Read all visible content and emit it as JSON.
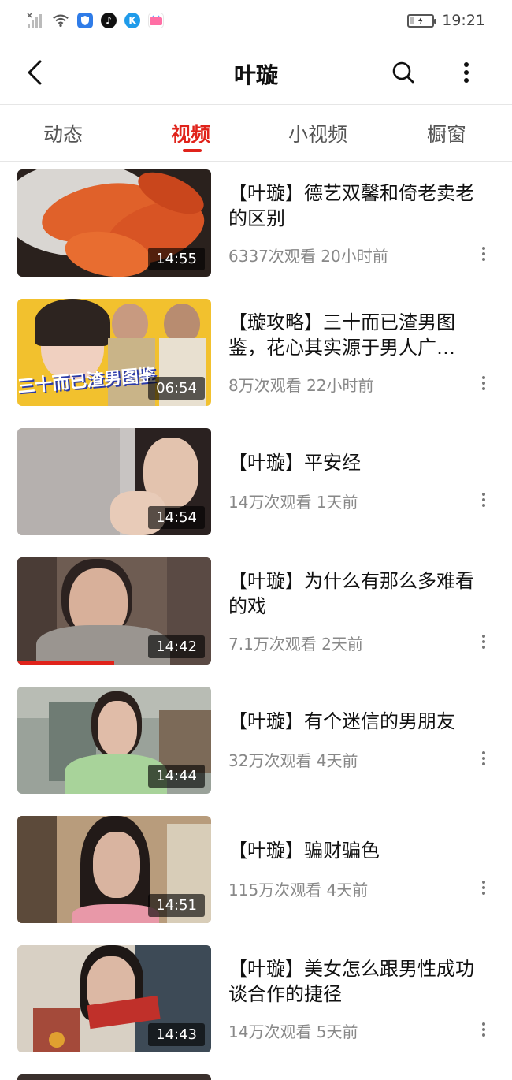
{
  "status_bar": {
    "time": "19:21",
    "icons": [
      "signal-icon",
      "wifi-icon",
      "shield-app-icon",
      "tiktok-app-icon",
      "k-app-icon",
      "bilibili-app-icon"
    ],
    "battery_level": 0.2
  },
  "header": {
    "title": "叶璇",
    "back_icon": "back-arrow-icon",
    "search_icon": "search-icon",
    "more_icon": "more-vertical-icon"
  },
  "tabs": [
    {
      "label": "动态",
      "active": false
    },
    {
      "label": "视频",
      "active": true
    },
    {
      "label": "小视频",
      "active": false
    },
    {
      "label": "橱窗",
      "active": false
    }
  ],
  "colors": {
    "accent": "#e0231b",
    "meta": "#888888"
  },
  "videos": [
    {
      "title": "【叶璇】德艺双馨和倚老卖老的区别",
      "meta": "6337次观看  20小时前",
      "duration": "14:55",
      "progress": 0
    },
    {
      "title": "【璇攻略】三十而已渣男图鉴，花心其实源于男人广…",
      "meta": "8万次观看  22小时前",
      "duration": "06:54",
      "progress": 0,
      "thumb_text": "三十而已渣男图鉴"
    },
    {
      "title": "【叶璇】平安经",
      "meta": "14万次观看  1天前",
      "duration": "14:54",
      "progress": 0
    },
    {
      "title": "【叶璇】为什么有那么多难看的戏",
      "meta": "7.1万次观看  2天前",
      "duration": "14:42",
      "progress": 0.5
    },
    {
      "title": "【叶璇】有个迷信的男朋友",
      "meta": "32万次观看  4天前",
      "duration": "14:44",
      "progress": 0
    },
    {
      "title": "【叶璇】骗财骗色",
      "meta": "115万次观看  4天前",
      "duration": "14:51",
      "progress": 0
    },
    {
      "title": "【叶璇】美女怎么跟男性成功谈合作的捷径",
      "meta": "14万次观看  5天前",
      "duration": "14:43",
      "progress": 0
    }
  ]
}
